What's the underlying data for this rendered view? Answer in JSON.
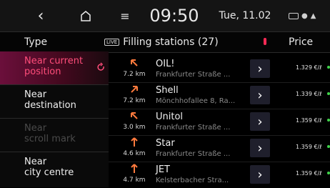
{
  "top": {
    "time": "09:50",
    "date": "Tue, 11.02"
  },
  "header": {
    "type_label": "Type",
    "live_badge": "LIVE",
    "title": "Filling stations (27)",
    "price_label": "Price"
  },
  "left_menu": [
    {
      "label_lines": [
        "Near current",
        "position"
      ],
      "active": true
    },
    {
      "label_lines": [
        "Near",
        "destination"
      ],
      "active": false
    },
    {
      "label_lines": [
        "Near",
        "scroll mark"
      ],
      "disabled": true
    },
    {
      "label_lines": [
        "Near",
        "city centre"
      ],
      "active": false
    }
  ],
  "stations": [
    {
      "name": "OIL!",
      "address": "Frankfurter Straße ...",
      "distance": "7.2 km",
      "price": "1.329 €/ℓ",
      "direction": "nw"
    },
    {
      "name": "Shell",
      "address": "Mönchhofallee 8, Ra...",
      "distance": "7.2 km",
      "price": "1.339 €/ℓ",
      "direction": "ne"
    },
    {
      "name": "Unitol",
      "address": "Frankfurter Straße ...",
      "distance": "3.0 km",
      "price": "1.359 €/ℓ",
      "direction": "nw"
    },
    {
      "name": "Star",
      "address": "Frankfurter Straße ...",
      "distance": "4.6 km",
      "price": "1.359 €/ℓ",
      "direction": "n"
    },
    {
      "name": "JET",
      "address": "Kelsterbacher Stra...",
      "distance": "4.7 km",
      "price": "1.359 €/ℓ",
      "direction": "n"
    }
  ],
  "colors": {
    "accent": "#ff4d7a",
    "arrow": "#ff7a3d",
    "price_dot": "#3fd34a"
  },
  "icons": {
    "back": "chevron-left-icon",
    "home": "home-icon",
    "menu": "menu-icon",
    "status": "status-icons",
    "refresh": "refresh-icon",
    "go": "chevron-right-icon"
  }
}
